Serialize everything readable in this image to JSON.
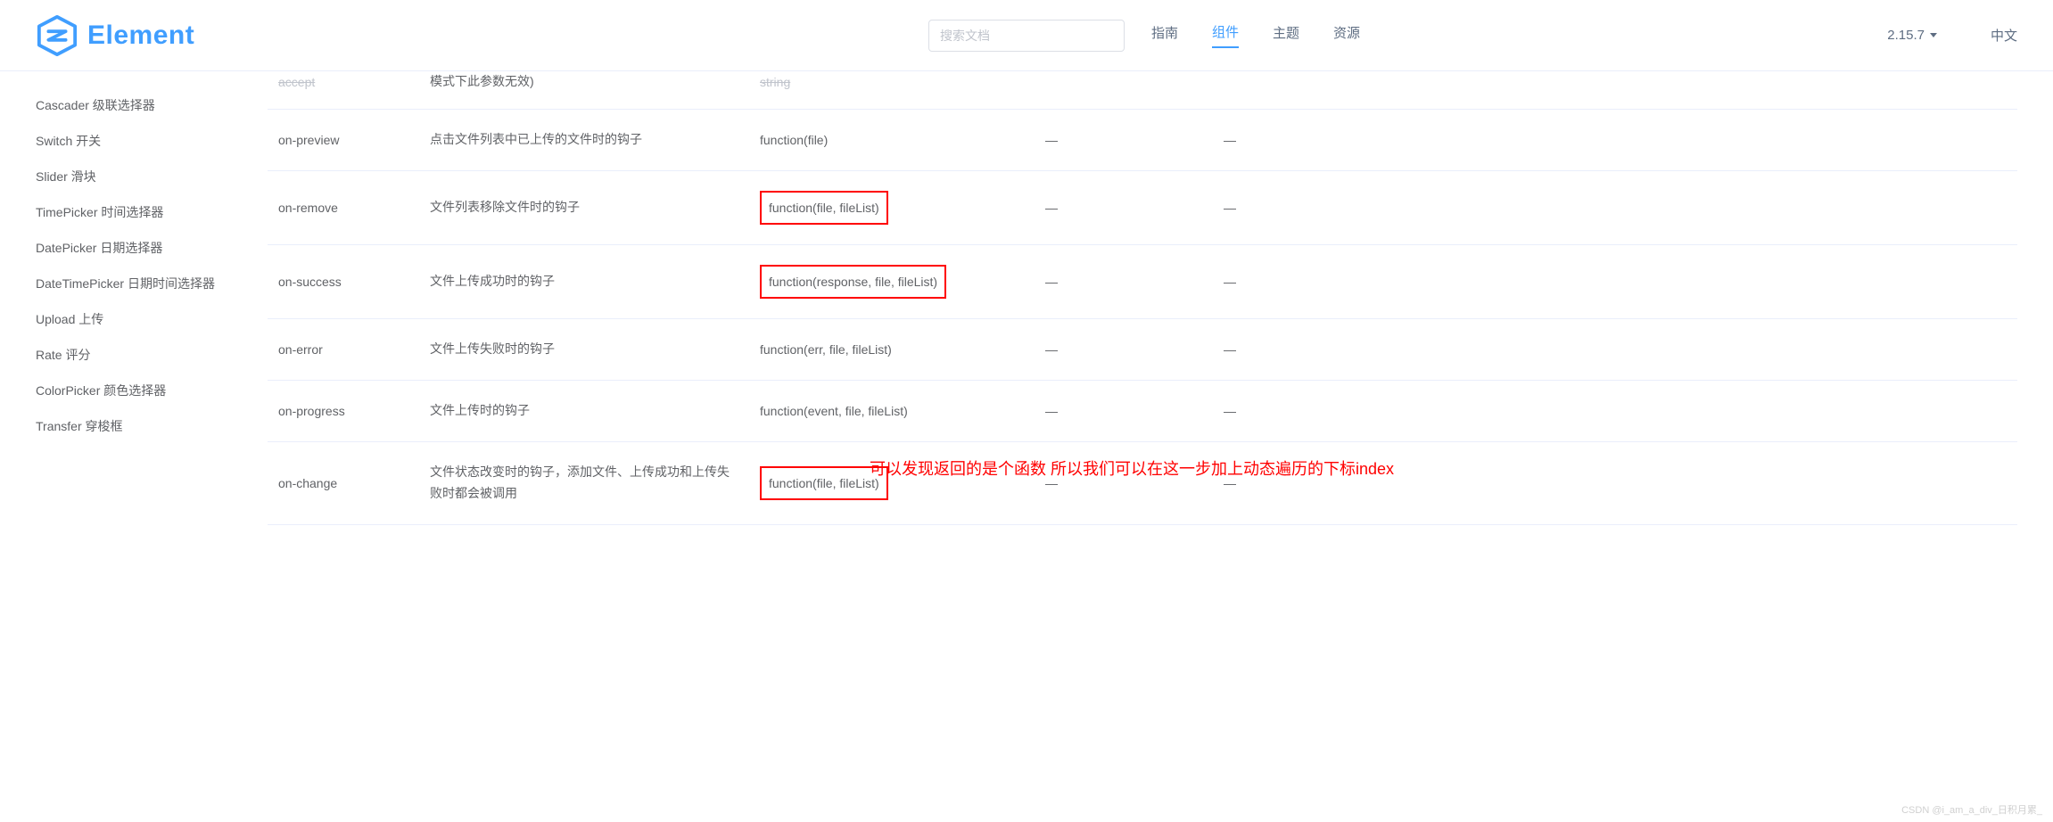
{
  "header": {
    "brand": "Element",
    "search_placeholder": "搜索文档",
    "nav": [
      "指南",
      "组件",
      "主题",
      "资源"
    ],
    "active_nav_index": 1,
    "version": "2.15.7",
    "lang": "中文"
  },
  "sidebar": {
    "items": [
      "Cascader 级联选择器",
      "Switch 开关",
      "Slider 滑块",
      "TimePicker 时间选择器",
      "DatePicker 日期选择器",
      "DateTimePicker 日期时间选择器",
      "Upload 上传",
      "Rate 评分",
      "ColorPicker 颜色选择器",
      "Transfer 穿梭框"
    ]
  },
  "table": {
    "rows": [
      {
        "name": "accept",
        "desc": "模式下此参数无效)",
        "type": "string",
        "opt": "—",
        "def": "—",
        "partial": true
      },
      {
        "name": "on-preview",
        "desc": "点击文件列表中已上传的文件时的钩子",
        "type": "function(file)",
        "opt": "—",
        "def": "—",
        "highlight": false
      },
      {
        "name": "on-remove",
        "desc": "文件列表移除文件时的钩子",
        "type": "function(file, fileList)",
        "opt": "—",
        "def": "—",
        "highlight": true
      },
      {
        "name": "on-success",
        "desc": "文件上传成功时的钩子",
        "type": "function(response, file, fileList)",
        "opt": "—",
        "def": "—",
        "highlight": true
      },
      {
        "name": "on-error",
        "desc": "文件上传失败时的钩子",
        "type": "function(err, file, fileList)",
        "opt": "—",
        "def": "—",
        "highlight": false
      },
      {
        "name": "on-progress",
        "desc": "文件上传时的钩子",
        "type": "function(event, file, fileList)",
        "opt": "—",
        "def": "—",
        "highlight": false
      },
      {
        "name": "on-change",
        "desc": "文件状态改变时的钩子，添加文件、上传成功和上传失败时都会被调用",
        "type": "function(file, fileList)",
        "opt": "—",
        "def": "—",
        "highlight": true
      }
    ]
  },
  "annotation": "可以发现返回的是个函数 所以我们可以在这一步加上动态遍历的下标index",
  "watermark": "CSDN @i_am_a_div_日积月累_"
}
